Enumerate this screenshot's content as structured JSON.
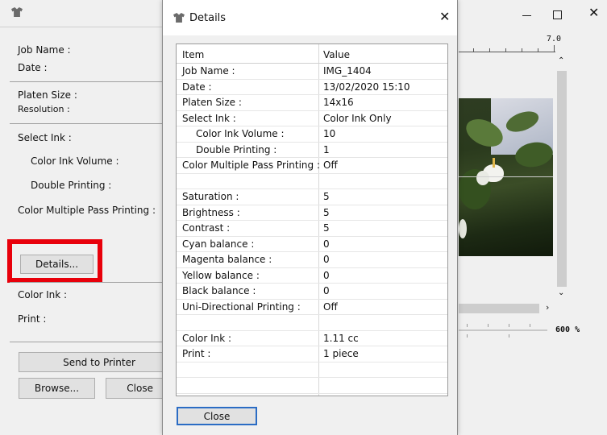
{
  "left_panel": {
    "job_name_label": "Job Name :",
    "date_label": "Date :",
    "platen_size_label": "Platen Size :",
    "resolution_label": "Resolution :",
    "select_ink_label": "Select Ink :",
    "color_ink_volume_label": "Color Ink Volume :",
    "double_printing_label": "Double Printing :",
    "color_multiple_pass_label": "Color Multiple Pass Printing :",
    "details_button": "Details...",
    "color_ink_label": "Color Ink :",
    "print_label": "Print :",
    "send_to_printer_button": "Send to Printer",
    "browse_button": "Browse...",
    "close_button": "Close"
  },
  "preview": {
    "ruler_value": "7.0",
    "zoom_level": "600 %"
  },
  "dialog": {
    "title": "Details",
    "column_item": "Item",
    "column_value": "Value",
    "close_button": "Close",
    "rows": [
      {
        "item": "Job Name :",
        "value": "IMG_1404"
      },
      {
        "item": "Date :",
        "value": "13/02/2020 15:10"
      },
      {
        "item": "Platen Size :",
        "value": "14x16"
      },
      {
        "item": "Select Ink :",
        "value": "Color Ink Only"
      },
      {
        "item": "Color Ink Volume :",
        "value": "10"
      },
      {
        "item": "Double Printing :",
        "value": "1"
      },
      {
        "item": "Color Multiple Pass Printing :",
        "value": "Off"
      },
      {
        "item": "",
        "value": ""
      },
      {
        "item": "Saturation :",
        "value": "5"
      },
      {
        "item": "Brightness :",
        "value": "5"
      },
      {
        "item": "Contrast :",
        "value": "5"
      },
      {
        "item": "Cyan balance :",
        "value": "0"
      },
      {
        "item": "Magenta balance :",
        "value": "0"
      },
      {
        "item": "Yellow balance :",
        "value": "0"
      },
      {
        "item": "Black balance :",
        "value": "0"
      },
      {
        "item": "Uni-Directional Printing :",
        "value": "Off"
      },
      {
        "item": "",
        "value": ""
      },
      {
        "item": "Color Ink :",
        "value": "1.11 cc"
      },
      {
        "item": "Print :",
        "value": "1 piece"
      },
      {
        "item": "",
        "value": ""
      },
      {
        "item": "",
        "value": ""
      }
    ]
  },
  "colors": {
    "highlight": "#e8000b",
    "window_bg": "#f0f0f0",
    "close_button_border": "#2b6cc4"
  }
}
